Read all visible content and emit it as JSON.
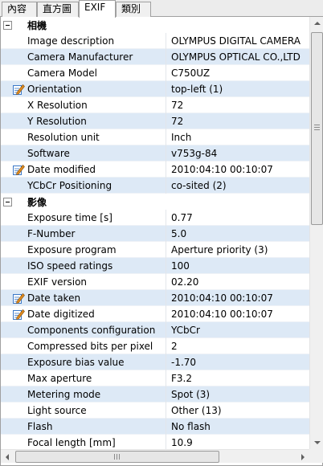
{
  "tabs": [
    {
      "label": "內容",
      "active": false
    },
    {
      "label": "直方圖",
      "active": false
    },
    {
      "label": "EXIF",
      "active": true
    },
    {
      "label": "類別",
      "active": false
    }
  ],
  "groups": [
    {
      "title": "相機",
      "rows": [
        {
          "property": "Image description",
          "value": "OLYMPUS DIGITAL CAMERA",
          "editable": false
        },
        {
          "property": "Camera Manufacturer",
          "value": "OLYMPUS OPTICAL CO.,LTD",
          "editable": false
        },
        {
          "property": "Camera Model",
          "value": "C750UZ",
          "editable": false
        },
        {
          "property": "Orientation",
          "value": "top-left (1)",
          "editable": true
        },
        {
          "property": "X Resolution",
          "value": "72",
          "editable": false
        },
        {
          "property": "Y Resolution",
          "value": "72",
          "editable": false
        },
        {
          "property": "Resolution unit",
          "value": "Inch",
          "editable": false
        },
        {
          "property": "Software",
          "value": "v753g-84",
          "editable": false
        },
        {
          "property": "Date modified",
          "value": "2010:04:10 00:10:07",
          "editable": true
        },
        {
          "property": "YCbCr Positioning",
          "value": "co-sited (2)",
          "editable": false
        }
      ]
    },
    {
      "title": "影像",
      "rows": [
        {
          "property": "Exposure time [s]",
          "value": "0.77",
          "editable": false
        },
        {
          "property": "F-Number",
          "value": "5.0",
          "editable": false
        },
        {
          "property": "Exposure program",
          "value": "Aperture priority (3)",
          "editable": false
        },
        {
          "property": "ISO speed ratings",
          "value": "100",
          "editable": false
        },
        {
          "property": "EXIF version",
          "value": "02.20",
          "editable": false
        },
        {
          "property": "Date taken",
          "value": "2010:04:10 00:10:07",
          "editable": true
        },
        {
          "property": "Date digitized",
          "value": "2010:04:10 00:10:07",
          "editable": true
        },
        {
          "property": "Components configuration",
          "value": "YCbCr",
          "editable": false
        },
        {
          "property": "Compressed bits per pixel",
          "value": "2",
          "editable": false
        },
        {
          "property": "Exposure bias value",
          "value": "-1.70",
          "editable": false
        },
        {
          "property": "Max aperture",
          "value": "F3.2",
          "editable": false
        },
        {
          "property": "Metering mode",
          "value": "Spot (3)",
          "editable": false
        },
        {
          "property": "Light source",
          "value": "Other (13)",
          "editable": false
        },
        {
          "property": "Flash",
          "value": "No flash",
          "editable": false
        },
        {
          "property": "Focal length [mm]",
          "value": "10.9",
          "editable": false
        }
      ]
    }
  ],
  "colors": {
    "alt_row": "#dde9f6",
    "border": "#a0a0a0",
    "edit_icon_pencil": "#e08a1e",
    "edit_icon_paper": "#3a78c8"
  },
  "icons": {
    "edit": "edit-icon",
    "collapse": "collapse-icon"
  }
}
